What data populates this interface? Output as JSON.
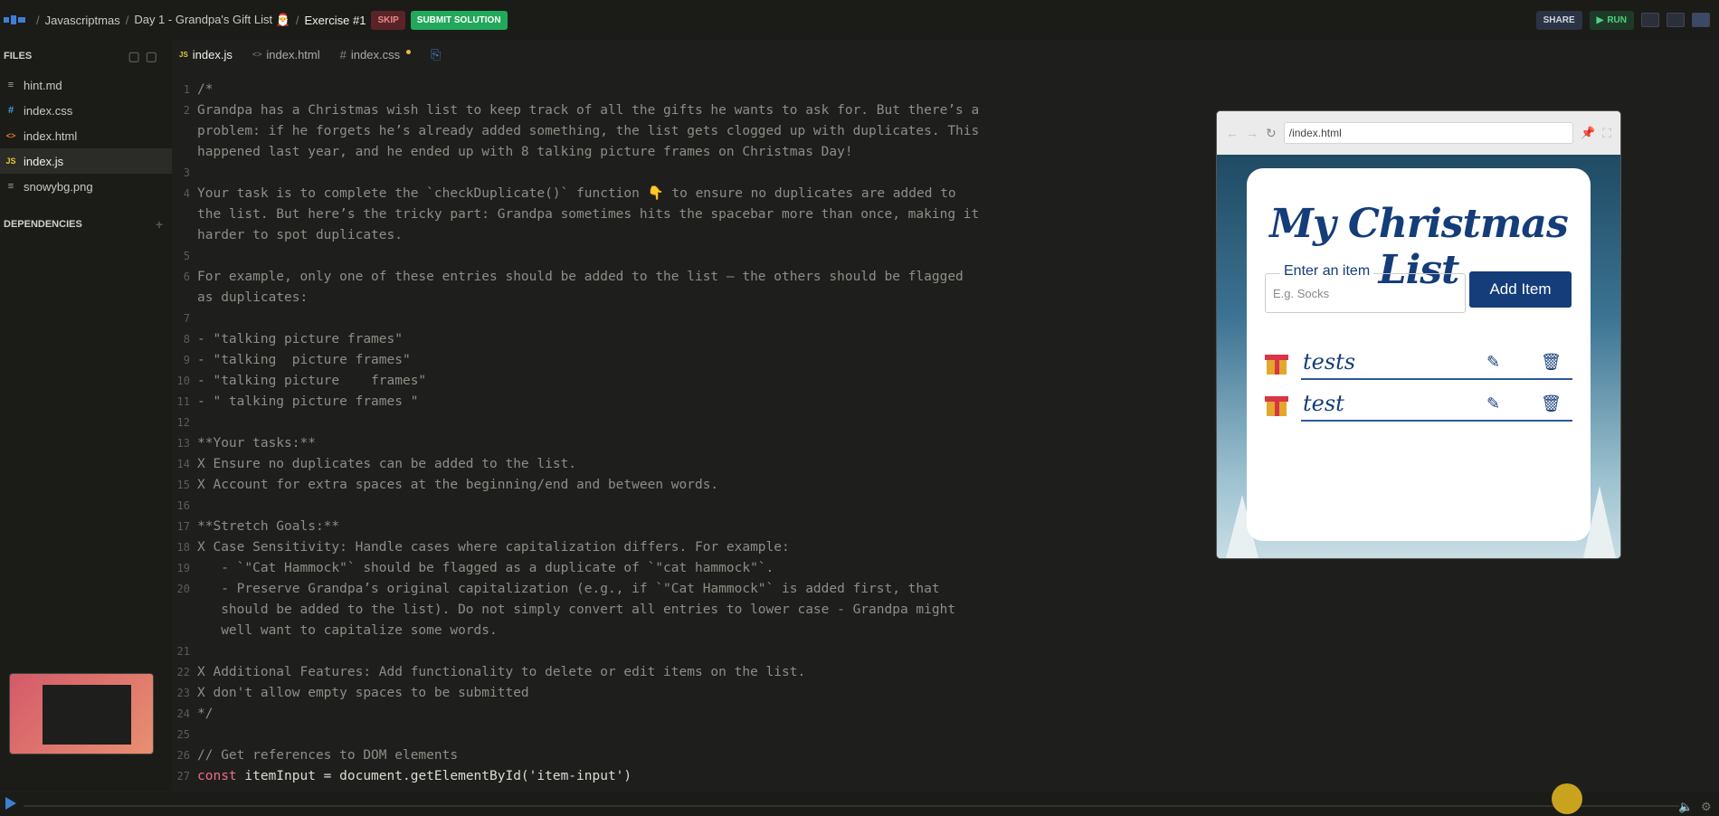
{
  "topbar": {
    "breadcrumb": [
      "Javascriptmas",
      "Day 1 - Grandpa's Gift List 🎅",
      "Exercise #1"
    ],
    "skip_label": "SKIP",
    "submit_label": "SUBMIT SOLUTION",
    "share_label": "SHARE",
    "run_label": "RUN"
  },
  "sidebar": {
    "files_header": "FILES",
    "files": [
      {
        "name": "hint.md",
        "icon": "≡",
        "color": "#9aa"
      },
      {
        "name": "index.css",
        "icon": "#",
        "color": "#3aa6e0"
      },
      {
        "name": "index.html",
        "icon": "<>",
        "color": "#e8743b"
      },
      {
        "name": "index.js",
        "icon": "JS",
        "color": "#e2c93a"
      },
      {
        "name": "snowybg.png",
        "icon": "≡",
        "color": "#9aa"
      }
    ],
    "deps_header": "DEPENDENCIES",
    "deps_add": "+"
  },
  "tabs": [
    {
      "label": "index.js",
      "icon": "JS"
    },
    {
      "label": "index.html",
      "icon": "<>"
    },
    {
      "label": "index.css",
      "icon": "#"
    }
  ],
  "code": [
    {
      "n": "1",
      "t": "/*"
    },
    {
      "n": "2",
      "t": "Grandpa has a Christmas wish list to keep track of all the gifts he wants to ask for. But there’s a"
    },
    {
      "n": "",
      "t": "problem: if he forgets he’s already added something, the list gets clogged up with duplicates. This"
    },
    {
      "n": "",
      "t": "happened last year, and he ended up with 8 talking picture frames on Christmas Day!"
    },
    {
      "n": "3",
      "t": ""
    },
    {
      "n": "4",
      "t": "Your task is to complete the `checkDuplicate()` function 👇 to ensure no duplicates are added to"
    },
    {
      "n": "",
      "t": "the list. But here’s the tricky part: Grandpa sometimes hits the spacebar more than once, making it"
    },
    {
      "n": "",
      "t": "harder to spot duplicates."
    },
    {
      "n": "5",
      "t": ""
    },
    {
      "n": "6",
      "t": "For example, only one of these entries should be added to the list — the others should be flagged"
    },
    {
      "n": "",
      "t": "as duplicates:"
    },
    {
      "n": "7",
      "t": ""
    },
    {
      "n": "8",
      "t": "- \"talking picture frames\""
    },
    {
      "n": "9",
      "t": "- \"talking  picture frames\""
    },
    {
      "n": "10",
      "t": "- \"talking picture    frames\""
    },
    {
      "n": "11",
      "t": "- \" talking picture frames \""
    },
    {
      "n": "12",
      "t": ""
    },
    {
      "n": "13",
      "t": "**Your tasks:**"
    },
    {
      "n": "14",
      "t": "X Ensure no duplicates can be added to the list."
    },
    {
      "n": "15",
      "t": "X Account for extra spaces at the beginning/end and between words."
    },
    {
      "n": "16",
      "t": ""
    },
    {
      "n": "17",
      "t": "**Stretch Goals:**"
    },
    {
      "n": "18",
      "t": "X Case Sensitivity: Handle cases where capitalization differs. For example:"
    },
    {
      "n": "19",
      "t": "   - `\"Cat Hammock\"` should be flagged as a duplicate of `\"cat hammock\"`."
    },
    {
      "n": "20",
      "t": "   - Preserve Grandpa’s original capitalization (e.g., if `\"Cat Hammock\"` is added first, that"
    },
    {
      "n": "",
      "t": "   should be added to the list). Do not simply convert all entries to lower case - Grandpa might"
    },
    {
      "n": "",
      "t": "   well want to capitalize some words."
    },
    {
      "n": "21",
      "t": ""
    },
    {
      "n": "22",
      "t": "X Additional Features: Add functionality to delete or edit items on the list."
    },
    {
      "n": "23",
      "t": "X don't allow empty spaces to be submitted"
    },
    {
      "n": "24",
      "t": "*/"
    },
    {
      "n": "25",
      "t": ""
    },
    {
      "n": "26",
      "t": "// Get references to DOM elements"
    }
  ],
  "code_last": {
    "n": "27",
    "kw": "const",
    "rest": " itemInput = document.getElementById('item-input')"
  },
  "preview": {
    "url": "/index.html",
    "title": "My Christmas List",
    "field_label": "Enter an item",
    "placeholder": "E.g. Socks",
    "add_button": "Add Item",
    "items": [
      "tests",
      "test"
    ]
  }
}
